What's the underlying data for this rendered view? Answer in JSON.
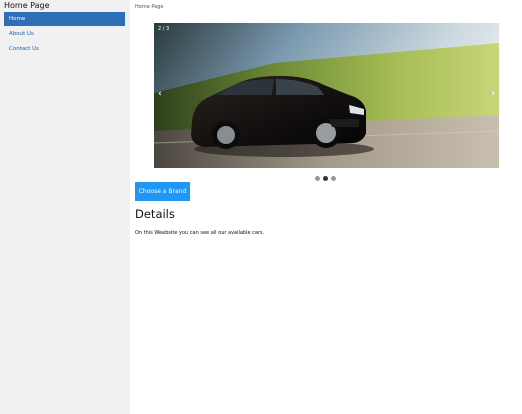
{
  "sidebar": {
    "title": "Home Page",
    "items": [
      {
        "label": "Home",
        "active": true
      },
      {
        "label": "About Us",
        "active": false
      },
      {
        "label": "Contact Us",
        "active": false
      }
    ]
  },
  "main": {
    "breadcrumb": "Home Page",
    "carousel": {
      "counter": "2 / 3",
      "prev_icon": "‹",
      "next_icon": "›",
      "slide_count": 3,
      "active_slide": 2
    },
    "brand_button_label": "Choose a Brand",
    "heading": "Details",
    "body_text": "On this Weebsite you can see all our available cars."
  },
  "colors": {
    "sidebar_bg": "#f1f1f1",
    "nav_active_bg": "#2e6fb7",
    "link": "#1f5fb0",
    "button_bg": "#2196f3"
  }
}
